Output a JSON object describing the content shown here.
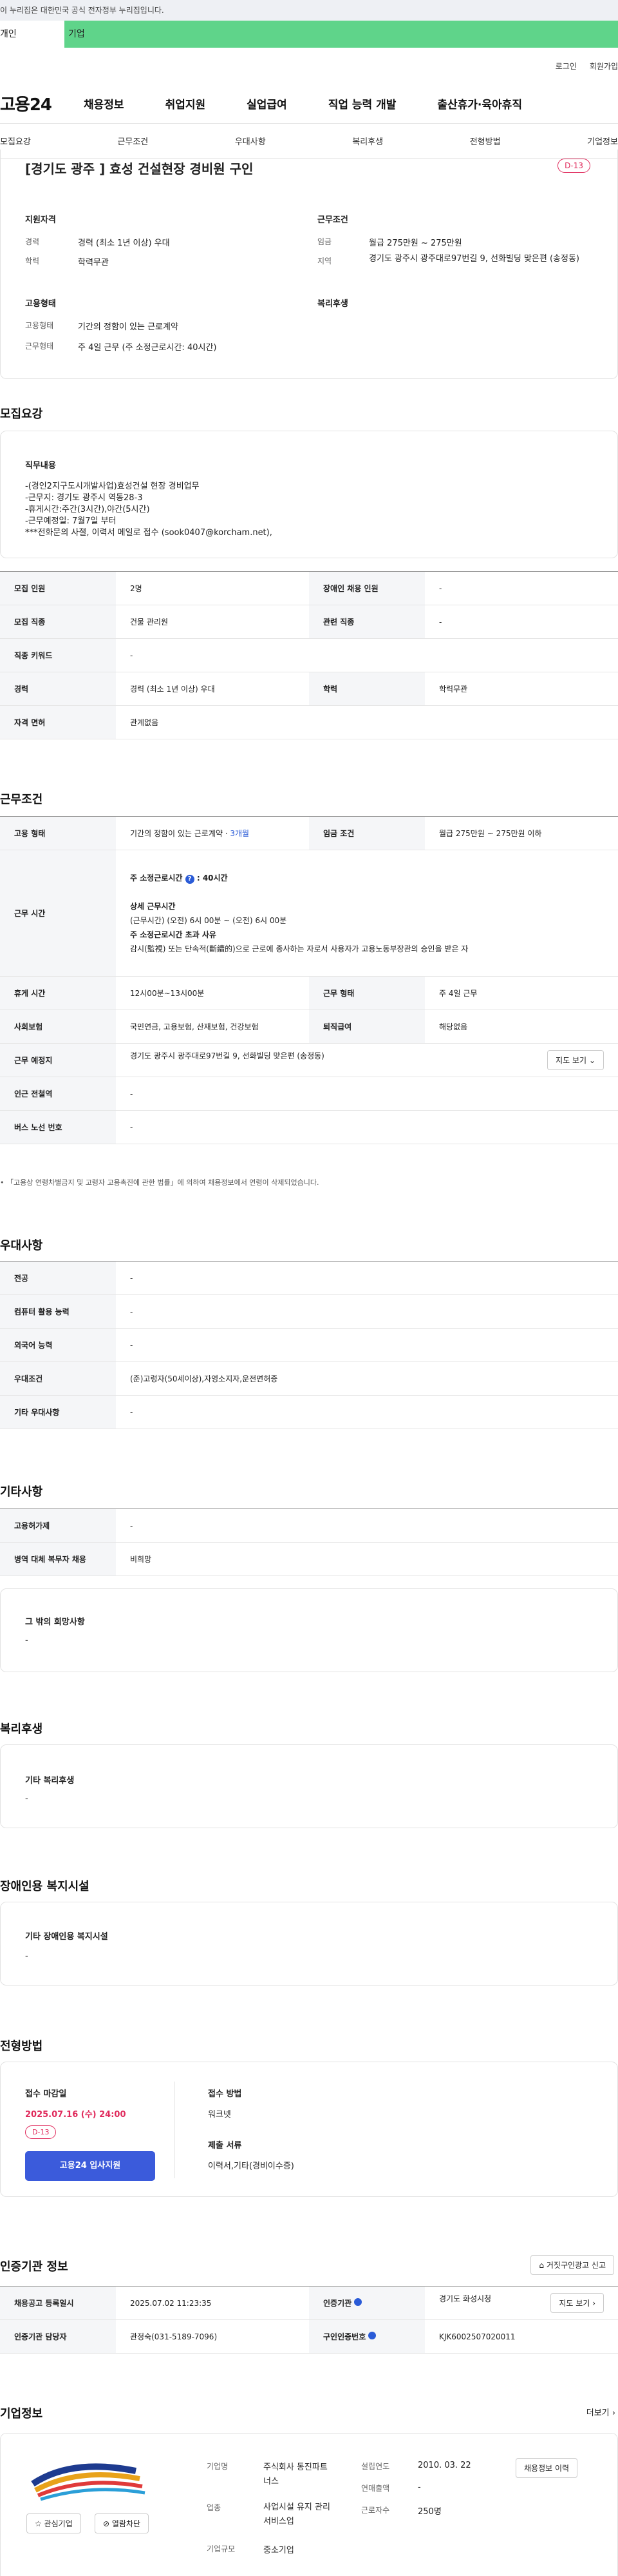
{
  "gov_banner": "이 누리집은 대한민국 공식 전자정부 누리집입니다.",
  "top_tabs": [
    "개인",
    "기업"
  ],
  "util": [
    "로그인",
    "회원가입"
  ],
  "logo": "고용24",
  "gnb": [
    "채용정보",
    "취업지원",
    "실업급여",
    "직업 능력 개발",
    "출산휴가·육아휴직"
  ],
  "subnav": [
    "모집요강",
    "근무조건",
    "우대사항",
    "복리후생",
    "전형방법",
    "기업정보"
  ],
  "summary": {
    "title": "[경기도 광주 ] 효성 건설현장 경비원 구인",
    "dday": "D-13",
    "qual_head": "지원자격",
    "career_lbl": "경력",
    "career_val": "경력 (최소 1년 이상) 우대",
    "edu_lbl": "학력",
    "edu_val": "학력무관",
    "cond_head": "근무조건",
    "wage_lbl": "임금",
    "wage_val": "월급 275만원 ~ 275만원",
    "area_lbl": "지역",
    "area_val": "경기도 광주시 광주대로97번길 9, 선화빌딩 맞은편 (송정동)",
    "emp_head": "고용형태",
    "type_lbl": "고용형태",
    "type_val": "기간의 정함이 있는 근로계약",
    "time_lbl": "근무형태",
    "time_val": "주 4일 근무 (주 소정근로시간: 40시간)",
    "welfare_head": "복리후생"
  },
  "recruit": {
    "heading": "모집요강",
    "job_head": "직무내용",
    "job_lines": [
      "-(경인2지구도시개발사업)효성건설 현장 경비업무",
      "-근무지: 경기도 광주시 역동28-3",
      "-휴게시간:주간(3시간),야간(5시간)",
      "-근무예정일: 7월7일 부터",
      "***전화문의 사절, 이력서 메일로 접수 (sook0407@korcham.net),"
    ],
    "rows": [
      [
        "모집 인원",
        "2명",
        "장애인 채용 인원",
        "-"
      ],
      [
        "모집 직종",
        "건물 관리원",
        "관련 직종",
        "-"
      ],
      [
        "직종 키워드",
        "-"
      ],
      [
        "경력",
        "경력 (최소 1년 이상) 우대",
        "학력",
        "학력무관"
      ],
      [
        "자격 면허",
        "관계없음"
      ]
    ]
  },
  "work": {
    "heading": "근무조건",
    "emp_type_lbl": "고용 형태",
    "emp_type_val": "기간의 정함이 있는 근로계약 · ",
    "emp_period": "3개월",
    "wage_lbl": "임금 조건",
    "wage_val": "월급 275만원 ~ 275만원 이하",
    "hours_lbl": "근무 시간",
    "hours_weekly_lbl": "주 소정근로시간",
    "hours_weekly_val": ": 40시간",
    "detail_lbl": "상세 근무시간",
    "detail_lines": [
      "(근무시간) (오전) 6시 00분 ~ (오전) 6시 00분"
    ],
    "overtime_lbl": "주 소정근로시간 초과 사유",
    "overtime_text": "감시(監視) 또는 단속적(斷續的)으로 근로에 종사하는 자로서 사용자가 고용노동부장관의 승인을 받은 자",
    "rows": [
      [
        "휴게 시간",
        "12시00분~13시00분",
        "근무 형태",
        "주 4일 근무"
      ],
      [
        "사회보험",
        "국민연금, 고용보험, 산재보험, 건강보험",
        "퇴직급여",
        "해당없음"
      ]
    ],
    "place_lbl": "근무 예정지",
    "place_val": "경기도 광주시 광주대로97번길 9, 선화빌딩 맞은편 (송정동)",
    "map_btn": "지도 보기",
    "station_lbl": "인근 전철역",
    "station_val": "-",
    "bus_lbl": "버스 노선 번호",
    "bus_val": "-",
    "note": "「고용상 연령차별금지 및 고령자 고용촉진에 관한 법률」에 의하여 채용정보에서 연령이 삭제되었습니다."
  },
  "pref": {
    "heading": "우대사항",
    "rows": [
      [
        "전공",
        "-"
      ],
      [
        "컴퓨터 활용 능력",
        "-"
      ],
      [
        "외국어 능력",
        "-"
      ],
      [
        "우대조건",
        "(준)고령자(50세이상),자영소지자,운전면허증"
      ],
      [
        "기타 우대사항",
        "-"
      ]
    ]
  },
  "etc": {
    "heading": "기타사항",
    "rows": [
      [
        "고용허가제",
        "-"
      ],
      [
        "병역 대체 복무자 채용",
        "비희망"
      ]
    ],
    "box_head": "그 밖의 희망사항",
    "box_val": "-"
  },
  "welfare": {
    "heading": "복리후생",
    "box_head": "기타 복리후생",
    "box_val": "-"
  },
  "disab": {
    "heading": "장애인용 복지시설",
    "box_head": "기타 장애인용 복지시설",
    "box_val": "-"
  },
  "apply": {
    "heading": "전형방법",
    "deadline_lbl": "접수 마감일",
    "deadline_val": "2025.07.16 (수) 24:00",
    "dday": "D-13",
    "apply_btn": "고용24 입사지원",
    "method_lbl": "접수 방법",
    "method_val": "워크넷",
    "docs_lbl": "제출 서류",
    "docs_val": "이력서,기타(경비이수증)"
  },
  "cert": {
    "heading": "인증기관 정보",
    "report_btn": "거짓구인광고 신고",
    "r1": [
      "채용공고 등록일시",
      "2025.07.02 11:23:35",
      "인증기관",
      "경기도 화성시청"
    ],
    "map_btn": "지도 보기",
    "r2": [
      "인증기관 담당자",
      "관정숙(031-5189-7096)",
      "구인인증번호",
      "KJK6002507020011"
    ]
  },
  "company": {
    "heading": "기업정보",
    "more": "더보기",
    "name_lbl": "기업명",
    "name_val": "주식회사 동진파트너스",
    "biz_lbl": "업종",
    "biz_val": "사업시설 유지 관리 서비스업",
    "size_lbl": "기업규모",
    "size_val": "중소기업",
    "year_lbl": "설립연도",
    "year_val": "2010. 03. 22",
    "sales_lbl": "연매출액",
    "sales_val": "-",
    "staff_lbl": "근로자수",
    "staff_val": "250명",
    "interest_btn": "관심기업",
    "follow_btn": "열람차단",
    "hist_btn": "채용정보 이력"
  }
}
